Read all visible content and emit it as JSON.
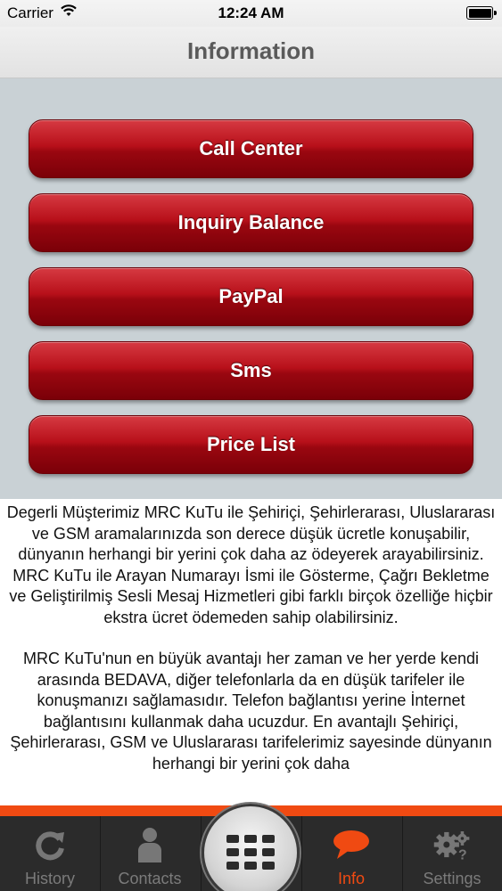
{
  "status_bar": {
    "carrier": "Carrier",
    "time": "12:24 AM",
    "battery_percent": 100
  },
  "nav": {
    "title": "Information"
  },
  "buttons": [
    {
      "label": "Call Center"
    },
    {
      "label": "Inquiry Balance"
    },
    {
      "label": "PayPal"
    },
    {
      "label": "Sms"
    },
    {
      "label": "Price List"
    }
  ],
  "info": {
    "paragraph_1": "Degerli Müşterimiz MRC KuTu ile  Şehiriçi, Şehirlerarası, Uluslararası ve GSM aramalarınızda son derece düşük ücretle konuşabilir, dünyanın herhangi bir yerini çok daha az ödeyerek arayabilirsiniz. MRC KuTu ile Arayan Numarayı İsmi ile Gösterme, Çağrı Bekletme ve Geliştirilmiş Sesli Mesaj Hizmetleri gibi farklı birçok özelliğe hiçbir ekstra ücret ödemeden sahip olabilirsiniz.",
    "paragraph_2": "MRC KuTu'nun en büyük avantajı her zaman ve her yerde kendi arasında BEDAVA, diğer telefonlarla da en düşük tarifeler ile konuşmanızı sağlamasıdır. Telefon bağlantısı yerine İnternet bağlantısını kullanmak daha ucuzdur. En avantajlı Şehiriçi, Şehirlerarası, GSM ve Uluslararası tarifelerimiz sayesinde dünyanın herhangi bir yerini çok daha"
  },
  "tabs": {
    "history": "History",
    "contacts": "Contacts",
    "info": "Info",
    "settings": "Settings",
    "active": "info"
  },
  "colors": {
    "accent": "#f04a12",
    "button_red": "#b8101a",
    "panel": "#c9d1d5",
    "tab_bar": "#2b2b2b"
  }
}
